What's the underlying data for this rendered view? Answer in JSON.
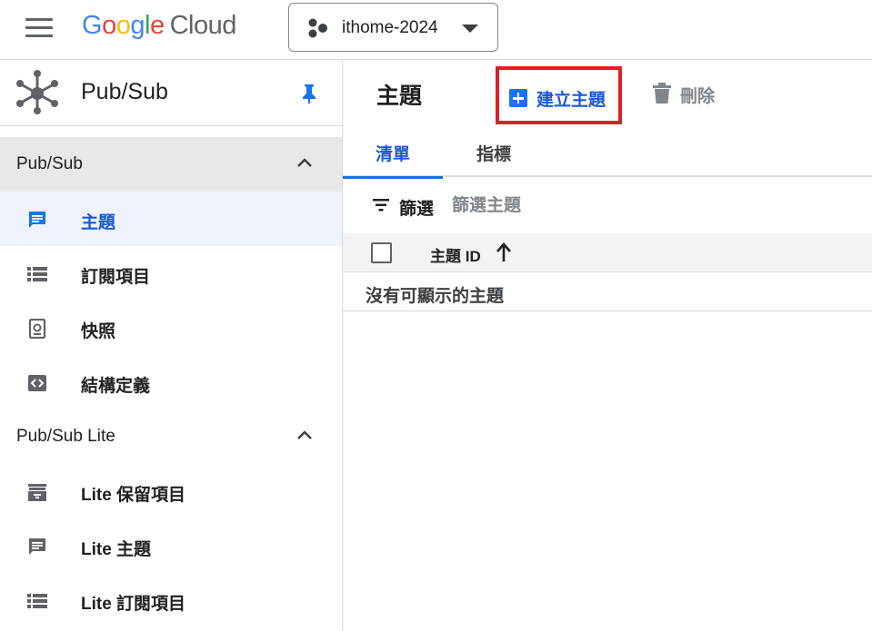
{
  "topbar": {
    "logo_letters": [
      "G",
      "o",
      "o",
      "g",
      "l",
      "e"
    ],
    "logo_cloud": "Cloud",
    "project_name": "ithome-2024"
  },
  "sidebar": {
    "product_title": "Pub/Sub",
    "sections": [
      {
        "label": "Pub/Sub",
        "items": [
          {
            "label": "主題",
            "icon": "message-icon",
            "active": true
          },
          {
            "label": "訂閱項目",
            "icon": "list-icon"
          },
          {
            "label": "快照",
            "icon": "snapshot-icon"
          },
          {
            "label": "結構定義",
            "icon": "code-icon"
          }
        ]
      },
      {
        "label": "Pub/Sub Lite",
        "items": [
          {
            "label": "Lite 保留項目",
            "icon": "reservation-icon"
          },
          {
            "label": "Lite 主題",
            "icon": "message-icon"
          },
          {
            "label": "Lite 訂閱項目",
            "icon": "list-icon"
          }
        ]
      }
    ]
  },
  "main": {
    "title": "主題",
    "create_label": "建立主題",
    "delete_label": "刪除",
    "tabs": [
      {
        "label": "清單",
        "active": true
      },
      {
        "label": "指標"
      }
    ],
    "filter_label": "篩選",
    "filter_placeholder": "篩選主題",
    "table": {
      "column_label": "主題 ID",
      "empty_text": "沒有可顯示的主題"
    }
  },
  "colors": {
    "accent": "#1a73e8",
    "active_text": "#1a56db",
    "highlight_border": "#e31d24",
    "active_bg": "#eef3fd"
  }
}
